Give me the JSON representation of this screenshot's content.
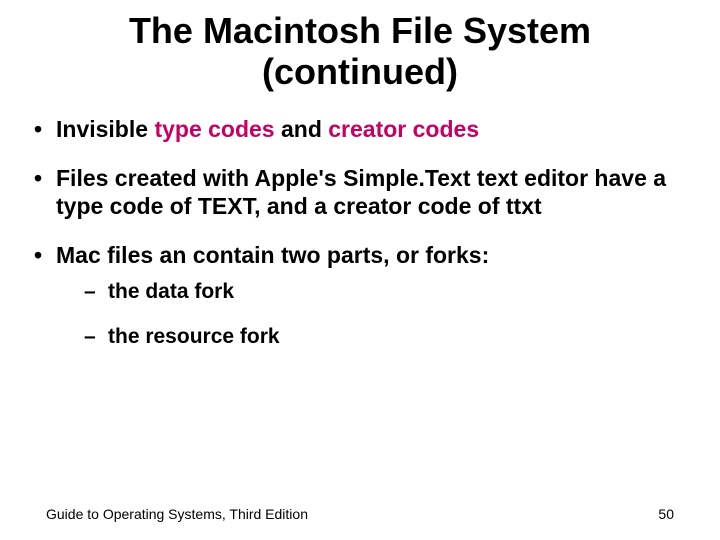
{
  "title": "The Macintosh File System (continued)",
  "bullets": {
    "b1": {
      "pre": "Invisible ",
      "hl1": "type codes",
      "mid": " and ",
      "hl2": "creator codes"
    },
    "b2": "Files created with Apple's Simple.Text text editor have a type code of TEXT, and a creator code of ttxt",
    "b3": "Mac files an contain two parts, or forks:",
    "sub1": "the data fork",
    "sub2": "the resource fork"
  },
  "footer": {
    "left": "Guide to Operating Systems, Third Edition",
    "right": "50"
  }
}
